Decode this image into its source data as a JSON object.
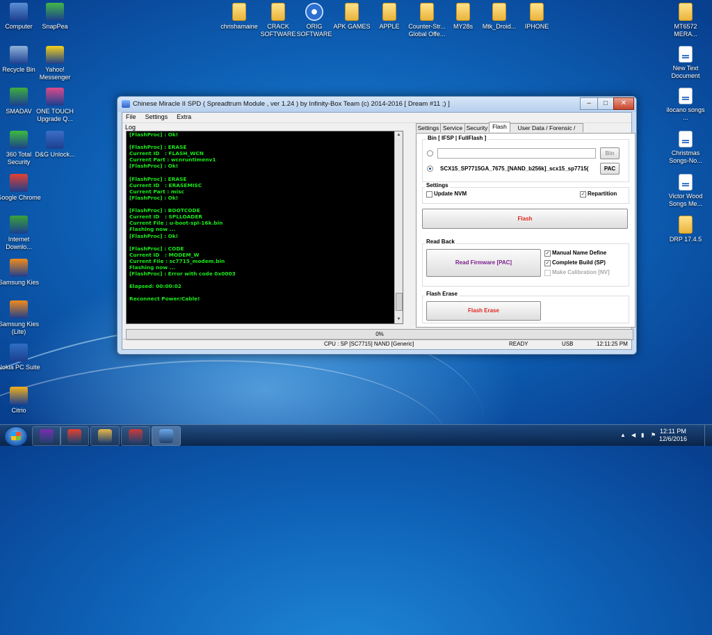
{
  "desktop": {
    "left_icons": [
      {
        "label": "Computer",
        "icon": "computer-icon",
        "color": "#5b8fd6"
      },
      {
        "label": "SnapPea",
        "icon": "snappea-icon",
        "color": "#43b649"
      },
      {
        "label": "Recycle Bin",
        "icon": "recycle-bin-icon",
        "color": "#8fb3d9"
      },
      {
        "label": "Yahoo! Messenger",
        "icon": "yahoo-messenger-icon",
        "color": "#f3d11a"
      },
      {
        "label": "SMADAV",
        "icon": "smadav-icon",
        "color": "#3fae3f"
      },
      {
        "label": "ONE TOUCH Upgrade Q...",
        "icon": "one-touch-icon",
        "color": "#d94b8c"
      },
      {
        "label": "360 Total Security",
        "icon": "360-security-icon",
        "color": "#3dbb3d"
      },
      {
        "label": "D&G Unlock...",
        "icon": "dg-unlock-icon",
        "color": "#3b6fc7"
      },
      {
        "label": "Google Chrome",
        "icon": "chrome-icon",
        "color": "#e44133"
      },
      {
        "label": "Internet Downlo...",
        "icon": "idm-icon",
        "color": "#3aa13a"
      },
      {
        "label": "Samsung Kies",
        "icon": "samsung-kies-icon",
        "color": "#f08a1c"
      },
      {
        "label": "Samsung Kies (Lite)",
        "icon": "samsung-kies-lite-icon",
        "color": "#f08a1c"
      },
      {
        "label": "Nokia PC Suite",
        "icon": "nokia-icon",
        "color": "#2f6fc4"
      },
      {
        "label": "Citrio",
        "icon": "citrio-icon",
        "color": "#f2b01e"
      }
    ],
    "top_icons": [
      {
        "label": "chrishamaine",
        "icon": "folder-icon"
      },
      {
        "label": "CRACK SOFTWARE",
        "icon": "folder-icon"
      },
      {
        "label": "ORIG SOFTWARE",
        "icon": "gear-folder-icon"
      },
      {
        "label": "APK GAMES",
        "icon": "folder-icon"
      },
      {
        "label": "APPLE",
        "icon": "folder-icon"
      },
      {
        "label": "Counter-Str... Global Offe...",
        "icon": "folder-icon"
      },
      {
        "label": "MY28s",
        "icon": "folder-icon"
      },
      {
        "label": "Mtk_Droid...",
        "icon": "folder-icon"
      },
      {
        "label": "IPHONE",
        "icon": "folder-icon"
      }
    ],
    "right_icons": [
      {
        "label": "MT6572 MERA...",
        "icon": "folder-icon"
      },
      {
        "label": "New Text Document",
        "icon": "text-document-icon"
      },
      {
        "label": "ilocano songs ...",
        "icon": "document-icon"
      },
      {
        "label": "Christmas Songs-No...",
        "icon": "document-icon"
      },
      {
        "label": "Victor Wood Songs Me...",
        "icon": "document-icon"
      },
      {
        "label": "DRP 17.4.5",
        "icon": "folder-icon"
      }
    ]
  },
  "window": {
    "title": "Chinese Miracle II SPD ( Spreadtrum Module , ver 1.24 ) by Infinity-Box Team (c) 2014-2016 [ Dream #11 ;) ]",
    "minimize": "–",
    "maximize": "□",
    "close": "✕",
    "menu": [
      "File",
      "Settings",
      "Extra"
    ],
    "log_label": "Log",
    "log_lines": [
      "[FlashProc] : Ok!",
      "",
      "[FlashProc] : ERASE",
      "Current ID   : FLASH_WCN",
      "Current Part : wcnruntimenv1",
      "[FlashProc] : Ok!",
      "",
      "[FlashProc] : ERASE",
      "Current ID   : ERASEMISC",
      "Current Part : misc",
      "[FlashProc] : Ok!",
      "",
      "[FlashProc] : BOOTCODE",
      "Current ID   : SPLLOADER",
      "Current File : u-boot-spl-16k.bin",
      "Flashing now ...",
      "[FlashProc] : Ok!",
      "",
      "[FlashProc] : CODE",
      "Current ID   : MODEM_W",
      "Current File : sc7715_modem.bin",
      "Flashing now ...",
      "[FlashProc] : Error with code 0x0003",
      "",
      "Elapsed: 00:00:02",
      "",
      "Reconnect Power/Cable!"
    ],
    "tabs": [
      "Settings",
      "Service",
      "Security",
      "Flash",
      "User Data / Forensic / Other"
    ],
    "active_tab": "Flash",
    "bin_group": {
      "label": "Bin  [ IFSP | FullFlash ]",
      "bin_value": "",
      "bin_button": "Bin",
      "pac_value": "SCX15_SP7715GA_7675_[NAND_b256k]_scx15_sp7715(",
      "pac_button": "PAC"
    },
    "settings_group": {
      "label": "Settings",
      "update_nvm": {
        "label": "Update NVM",
        "checked": false
      },
      "repartition": {
        "label": "Repartition",
        "checked": true
      }
    },
    "flash_button": "Flash",
    "read_back": {
      "label": "Read Back",
      "read_button": "Read Firmware [PAC]",
      "manual_name": {
        "label": "Manual Name Define",
        "checked": true
      },
      "complete_build": {
        "label": "Complete Build (SP)",
        "checked": true
      },
      "make_calibration": {
        "label": "Make Calibration [NV]",
        "checked": false
      }
    },
    "flash_erase": {
      "label": "Flash Erase",
      "button": "Flash Erase"
    },
    "progress_text": "0%",
    "status": {
      "cpu": "CPU : SP [SC7715] NAND [Generic]",
      "state": "READY",
      "port": "USB",
      "time": "12:11:25 PM"
    },
    "colors": {
      "log_text": "#1be81b",
      "flash_red": "#e0281e",
      "read_purple": "#7a1e8c"
    }
  },
  "taskbar": {
    "clock_time": "12:11 PM",
    "clock_date": "12/6/2016",
    "buttons": [
      {
        "icon": "yahoo-messenger-icon",
        "color": "#7b2fb0"
      },
      {
        "icon": "chrome-icon",
        "color": "#e44133"
      },
      {
        "icon": "explorer-folder-icon",
        "color": "#e8b84a"
      },
      {
        "icon": "toolbox-icon",
        "color": "#c93b3b"
      },
      {
        "icon": "spd-icon",
        "color": "#6aa8e8",
        "active": true
      }
    ]
  }
}
